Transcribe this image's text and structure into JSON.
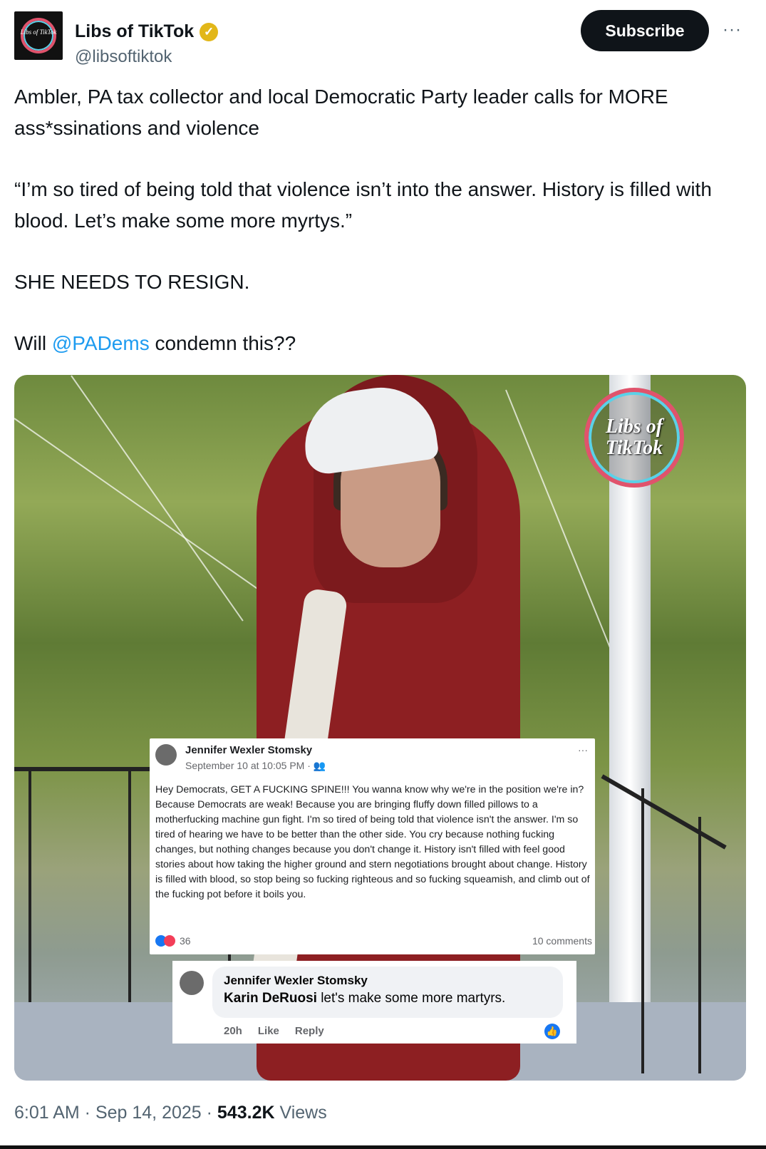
{
  "author": {
    "display_name": "Libs of TikTok",
    "handle": "@libsoftiktok",
    "avatar_text": "Libs of TikTok"
  },
  "actions": {
    "subscribe_label": "Subscribe",
    "more_label": "···"
  },
  "tweet": {
    "line1": "Ambler, PA tax collector and local Democratic Party leader calls for MORE ass*ssinations and violence",
    "quote": "“I’m so tired of being told that violence isn’t into the answer. History is filled with blood. Let’s make some more myrtys.”",
    "line3": "SHE NEEDS TO RESIGN.",
    "will_prefix": "Will ",
    "mention": "@PADems",
    "will_suffix": " condemn this??"
  },
  "media": {
    "watermark": "Libs of TikTok",
    "fb_post": {
      "author": "Jennifer Wexler Stomsky",
      "date": "September 10 at 10:05 PM · ",
      "more": "···",
      "text": "Hey Democrats, GET A FUCKING SPINE!!! You wanna know why we're in the position we're in? Because Democrats are weak! Because you are bringing fluffy down filled pillows to a motherfucking machine gun fight. I'm so tired of being told that violence isn't the answer. I'm so tired of hearing we have to be better than the other side. You cry because nothing fucking changes, but nothing changes because you don't change it. History isn't filled with feel good stories about how taking the higher ground and stern negotiations brought about change. History is filled with blood, so stop being so fucking righteous and so fucking squeamish, and climb out of the fucking pot before it boils you.",
      "reactions": "36",
      "comments": "10 comments"
    },
    "fb_comment": {
      "author": "Jennifer Wexler Stomsky",
      "tagged": "Karin DeRuosi",
      "text": " let's make some more martyrs.",
      "time": "20h",
      "like": "Like",
      "reply": "Reply"
    }
  },
  "footer": {
    "time": "6:01 AM · Sep 14, 2025 · ",
    "views_count": "543.2K",
    "views_label": " Views"
  },
  "colors": {
    "accent": "#1d9bf0",
    "subscribe_bg": "#0f1419",
    "verified": "#e2b719"
  }
}
